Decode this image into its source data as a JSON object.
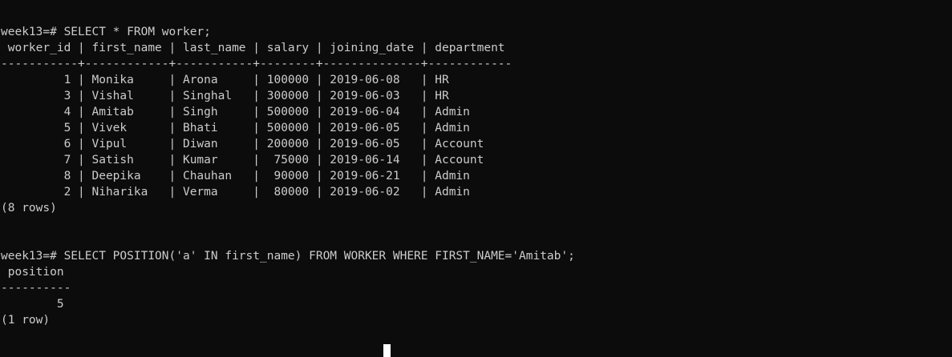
{
  "terminal": {
    "query1": {
      "prompt": "week13=# SELECT * FROM worker;",
      "header": " worker_id | first_name | last_name | salary | joining_date | department",
      "separator": "-----------+------------+-----------+--------+--------------+------------",
      "rows": [
        "         1 | Monika     | Arona     | 100000 | 2019-06-08   | HR",
        "         3 | Vishal     | Singhal   | 300000 | 2019-06-03   | HR",
        "         4 | Amitab     | Singh     | 500000 | 2019-06-04   | Admin",
        "         5 | Vivek      | Bhati     | 500000 | 2019-06-05   | Admin",
        "         6 | Vipul      | Diwan     | 200000 | 2019-06-05   | Account",
        "         7 | Satish     | Kumar     |  75000 | 2019-06-14   | Account",
        "         8 | Deepika    | Chauhan   |  90000 | 2019-06-21   | Admin",
        "         2 | Niharika   | Verma     |  80000 | 2019-06-02   | Admin"
      ],
      "footer": "(8 rows)"
    },
    "query2": {
      "prompt": "week13=# SELECT POSITION('a' IN first_name) FROM WORKER WHERE FIRST_NAME='Amitab';",
      "header": " position",
      "separator": "----------",
      "rows": [
        "        5"
      ],
      "footer": "(1 row)"
    }
  }
}
